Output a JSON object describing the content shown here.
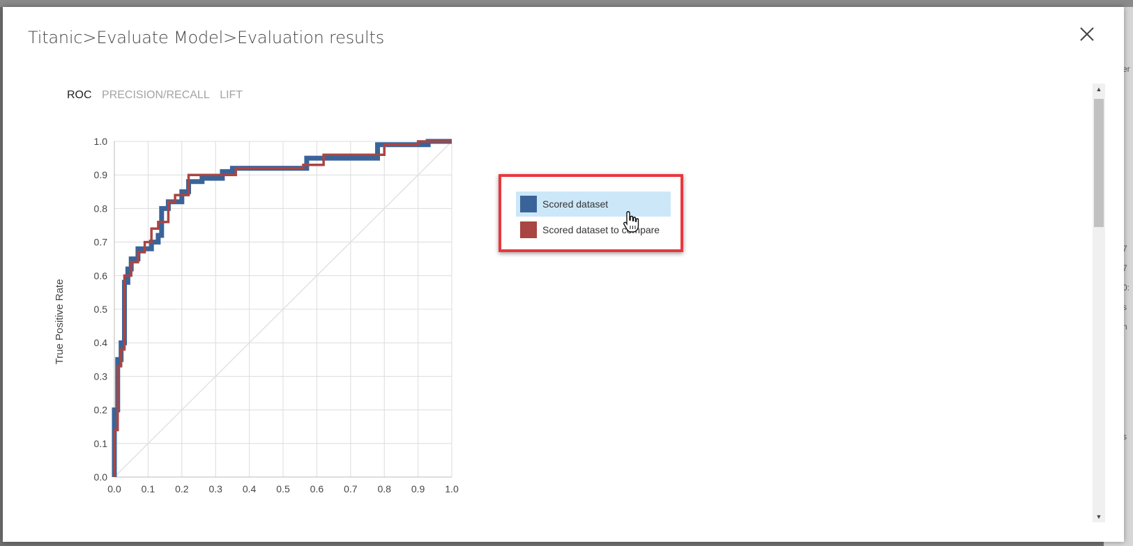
{
  "breadcrumb": [
    "Titanic",
    ">",
    "Evaluate Model",
    ">",
    "Evaluation results"
  ],
  "close_icon": "close-x-icon",
  "tabs": [
    {
      "label": "ROC",
      "active": true
    },
    {
      "label": "PRECISION/RECALL",
      "active": false
    },
    {
      "label": "LIFT",
      "active": false
    }
  ],
  "chart_data": {
    "type": "line",
    "ylabel": "True Positive Rate",
    "xlabel": "",
    "xlim": [
      0,
      1
    ],
    "ylim": [
      0,
      1
    ],
    "x_ticks": [
      "0.0",
      "0.1",
      "0.2",
      "0.3",
      "0.4",
      "0.5",
      "0.6",
      "0.7",
      "0.8",
      "0.9",
      "1.0"
    ],
    "y_ticks": [
      "0.0",
      "0.1",
      "0.2",
      "0.3",
      "0.4",
      "0.5",
      "0.6",
      "0.7",
      "0.8",
      "0.9",
      "1.0"
    ],
    "grid": true,
    "legend_position": "right",
    "series": [
      {
        "name": "Scored dataset",
        "color": "#3a6499",
        "x": [
          0,
          0,
          0.01,
          0.01,
          0.02,
          0.02,
          0.03,
          0.03,
          0.04,
          0.04,
          0.05,
          0.05,
          0.07,
          0.07,
          0.11,
          0.11,
          0.13,
          0.13,
          0.14,
          0.14,
          0.16,
          0.16,
          0.2,
          0.2,
          0.22,
          0.22,
          0.26,
          0.26,
          0.32,
          0.32,
          0.35,
          0.35,
          0.57,
          0.57,
          0.78,
          0.78,
          0.93,
          0.93,
          1.0
        ],
        "y": [
          0,
          0.2,
          0.2,
          0.35,
          0.35,
          0.4,
          0.4,
          0.58,
          0.58,
          0.62,
          0.62,
          0.65,
          0.65,
          0.68,
          0.68,
          0.7,
          0.7,
          0.72,
          0.72,
          0.8,
          0.8,
          0.82,
          0.82,
          0.85,
          0.85,
          0.88,
          0.88,
          0.89,
          0.89,
          0.91,
          0.91,
          0.92,
          0.92,
          0.95,
          0.95,
          0.99,
          0.99,
          1.0,
          1.0
        ]
      },
      {
        "name": "Scored dataset to compare",
        "color": "#a94542",
        "x": [
          0,
          0,
          0.01,
          0.01,
          0.02,
          0.02,
          0.03,
          0.03,
          0.05,
          0.05,
          0.07,
          0.07,
          0.09,
          0.09,
          0.11,
          0.11,
          0.13,
          0.13,
          0.16,
          0.16,
          0.18,
          0.18,
          0.22,
          0.22,
          0.3,
          0.3,
          0.36,
          0.36,
          0.56,
          0.56,
          0.62,
          0.62,
          0.8,
          0.8,
          0.9,
          0.9,
          1.0
        ],
        "y": [
          0,
          0.14,
          0.14,
          0.33,
          0.33,
          0.38,
          0.38,
          0.6,
          0.6,
          0.64,
          0.64,
          0.67,
          0.67,
          0.7,
          0.7,
          0.74,
          0.74,
          0.76,
          0.76,
          0.82,
          0.82,
          0.84,
          0.84,
          0.9,
          0.9,
          0.9,
          0.9,
          0.92,
          0.92,
          0.93,
          0.93,
          0.96,
          0.96,
          0.99,
          0.99,
          1.0,
          1.0
        ]
      }
    ],
    "diagonal_color": "#e2e2e2"
  },
  "legend": {
    "items": [
      {
        "label": "Scored dataset",
        "color": "#3a6499",
        "hovered": true
      },
      {
        "label": "Scored dataset to compare",
        "color": "#a94542",
        "hovered": false
      }
    ],
    "highlight_border_color": "#e8383e"
  },
  "cursor_icon": "hand-pointer-icon",
  "scrollbar": {
    "up_icon": "scroll-up-arrow-icon",
    "down_icon": "scroll-down-arrow-icon"
  },
  "background_edge_chars": [
    "er",
    "7",
    "7",
    "0:",
    "s",
    "n",
    "s"
  ]
}
